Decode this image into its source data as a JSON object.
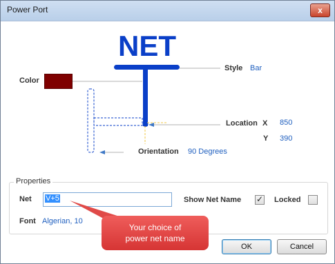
{
  "window": {
    "title": "Power Port",
    "close_glyph": "x"
  },
  "diagram": {
    "net_text": "NET",
    "style_label": "Style",
    "style_value": "Bar",
    "color_label": "Color",
    "color_value": "#7f0000",
    "location_label": "Location",
    "x_label": "X",
    "x_value": "850",
    "y_label": "Y",
    "y_value": "390",
    "orientation_label": "Orientation",
    "orientation_value": "90 Degrees"
  },
  "properties": {
    "group_title": "Properties",
    "net_label": "Net",
    "net_value": "V+5",
    "show_net_name_label": "Show Net Name",
    "show_net_name_checked": true,
    "locked_label": "Locked",
    "locked_checked": false,
    "font_label": "Font",
    "font_value": "Algerian, 10"
  },
  "callout": {
    "line1": "Your choice of",
    "line2": "power net name"
  },
  "buttons": {
    "ok": "OK",
    "cancel": "Cancel"
  },
  "colors": {
    "accent_blue": "#0a3fc8",
    "link_blue": "#1f5fbf",
    "callout_red": "#d63534"
  }
}
